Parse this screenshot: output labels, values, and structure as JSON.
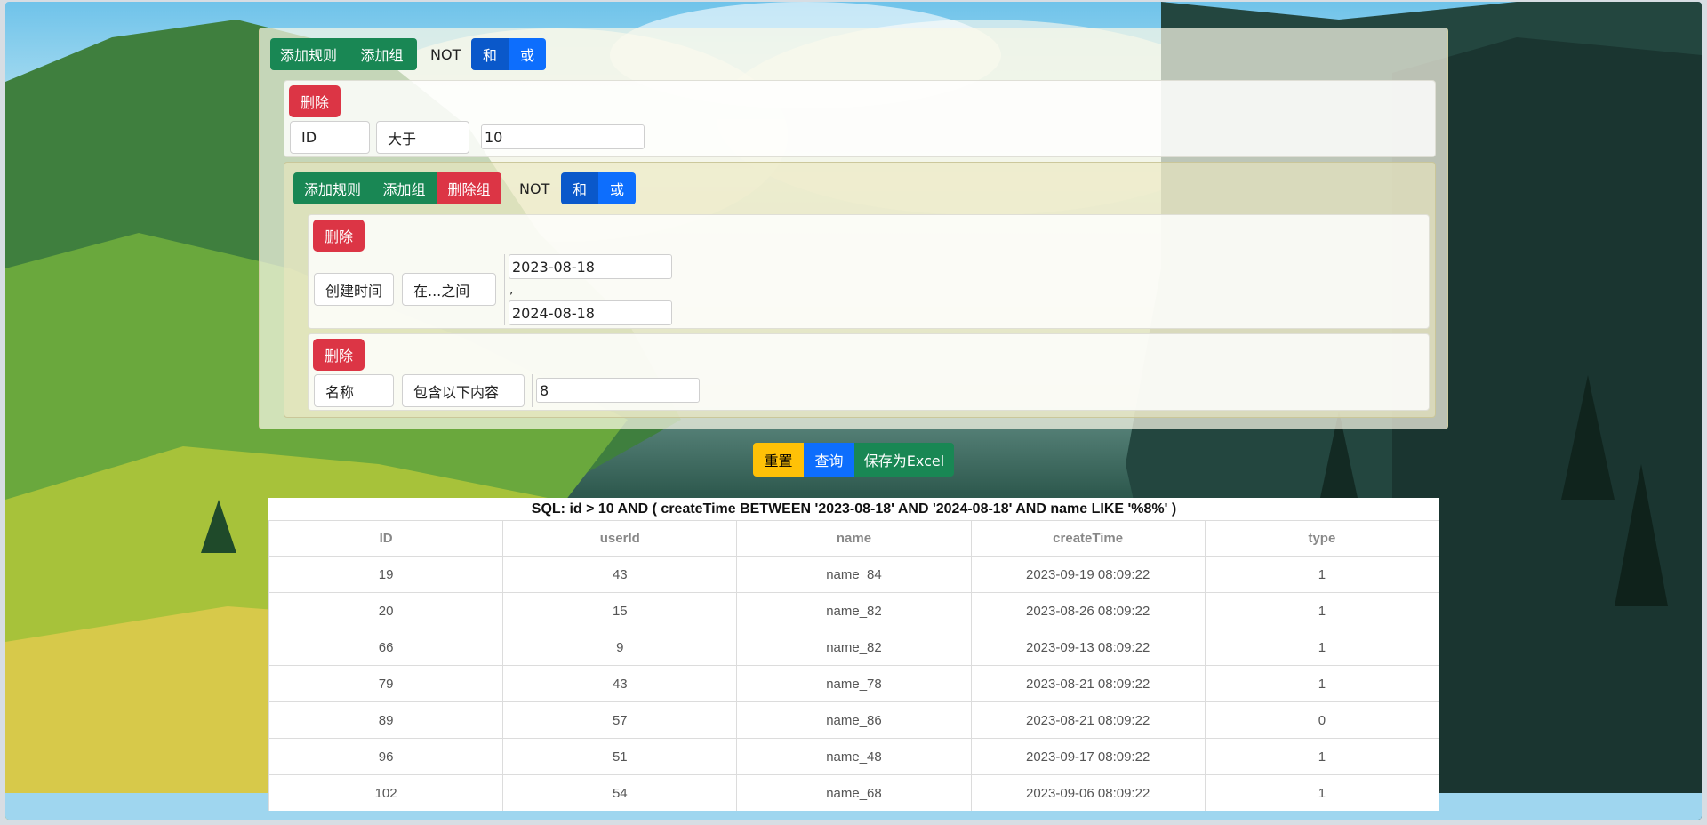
{
  "builder": {
    "root": {
      "add_rule": "添加规则",
      "add_group": "添加组",
      "not_label": "NOT",
      "and_label": "和",
      "or_label": "或"
    },
    "rule1": {
      "delete": "删除",
      "field": "ID",
      "operator": "大于",
      "value": "10"
    },
    "group": {
      "add_rule": "添加规则",
      "add_group": "添加组",
      "delete_group": "删除组",
      "not_label": "NOT",
      "and_label": "和",
      "or_label": "或",
      "rule2": {
        "delete": "删除",
        "field": "创建时间",
        "operator": "在...之间",
        "value_from": "2023-08-18",
        "separator": ",",
        "value_to": "2024-08-18"
      },
      "rule3": {
        "delete": "删除",
        "field": "名称",
        "operator": "包含以下内容",
        "value": "8"
      }
    }
  },
  "actions": {
    "reset": "重置",
    "query": "查询",
    "export": "保存为Excel"
  },
  "result": {
    "sql": "SQL:  id > 10 AND ( createTime BETWEEN '2023-08-18' AND '2024-08-18' AND name LIKE '%8%' )",
    "columns": [
      "ID",
      "userId",
      "name",
      "createTime",
      "type"
    ],
    "rows": [
      [
        "19",
        "43",
        "name_84",
        "2023-09-19 08:09:22",
        "1"
      ],
      [
        "20",
        "15",
        "name_82",
        "2023-08-26 08:09:22",
        "1"
      ],
      [
        "66",
        "9",
        "name_82",
        "2023-09-13 08:09:22",
        "1"
      ],
      [
        "79",
        "43",
        "name_78",
        "2023-08-21 08:09:22",
        "1"
      ],
      [
        "89",
        "57",
        "name_86",
        "2023-08-21 08:09:22",
        "0"
      ],
      [
        "96",
        "51",
        "name_48",
        "2023-09-17 08:09:22",
        "1"
      ],
      [
        "102",
        "54",
        "name_68",
        "2023-09-06 08:09:22",
        "1"
      ]
    ]
  },
  "colors": {
    "success": "#198754",
    "danger": "#dc3545",
    "primary": "#0d6efd",
    "primary_active": "#0a58ca",
    "warning": "#ffc107"
  }
}
